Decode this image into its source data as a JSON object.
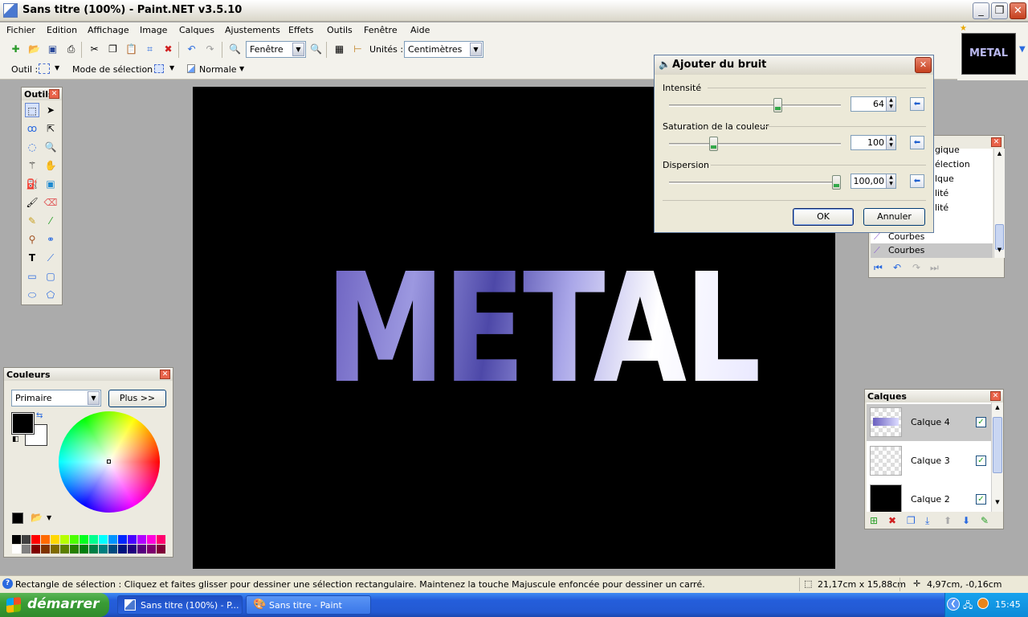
{
  "window": {
    "title": "Sans titre (100%) - Paint.NET v3.5.10"
  },
  "menu": [
    "Fichier",
    "Edition",
    "Affichage",
    "Image",
    "Calques",
    "Ajustements",
    "Effets",
    "Outils",
    "Fenêtre",
    "Aide"
  ],
  "toolbar": {
    "zoom_value": "Fenêtre",
    "units_label": "Unités :",
    "units_value": "Centimètres"
  },
  "toolbar2": {
    "tool_label": "Outil :",
    "selection_mode_label": "Mode de sélection :",
    "blend_mode": "Normale"
  },
  "thumbnail_text": "METAL",
  "canvas": {
    "text": "METAL"
  },
  "tools_panel": {
    "title": "Outils"
  },
  "colors_panel": {
    "title": "Couleurs",
    "mode": "Primaire",
    "more_button": "Plus >>",
    "primary_color": "#000000",
    "secondary_color": "#ffffff"
  },
  "dialog": {
    "title": "Ajouter du bruit",
    "groups": [
      {
        "label": "Intensité",
        "value": "64",
        "level": 64,
        "max": 100
      },
      {
        "label": "Saturation de la couleur",
        "value": "100",
        "level": 100,
        "max": 400
      },
      {
        "label": "Dispersion",
        "value": "100,00",
        "level": 100,
        "max": 100
      }
    ],
    "ok": "OK",
    "cancel": "Annuler"
  },
  "history_panel": {
    "items": [
      "gique",
      "élection",
      "lque",
      "lité",
      "lité",
      "Courbes",
      "Courbes"
    ]
  },
  "layers_panel": {
    "title": "Calques",
    "layers": [
      {
        "name": "Calque 4",
        "visible": true,
        "selected": true
      },
      {
        "name": "Calque 3",
        "visible": true,
        "selected": false
      },
      {
        "name": "Calque 2",
        "visible": true,
        "selected": false
      }
    ]
  },
  "statusbar": {
    "hint": "Rectangle de sélection : Cliquez et faites glisser pour dessiner une sélection rectangulaire. Maintenez la touche Majuscule enfoncée pour dessiner un carré.",
    "size": "21,17cm x 15,88cm",
    "position": "4,97cm, -0,16cm"
  },
  "taskbar": {
    "start": "démarrer",
    "tasks": [
      "Sans titre (100%) - P...",
      "Sans titre - Paint"
    ],
    "clock": "15:45"
  }
}
